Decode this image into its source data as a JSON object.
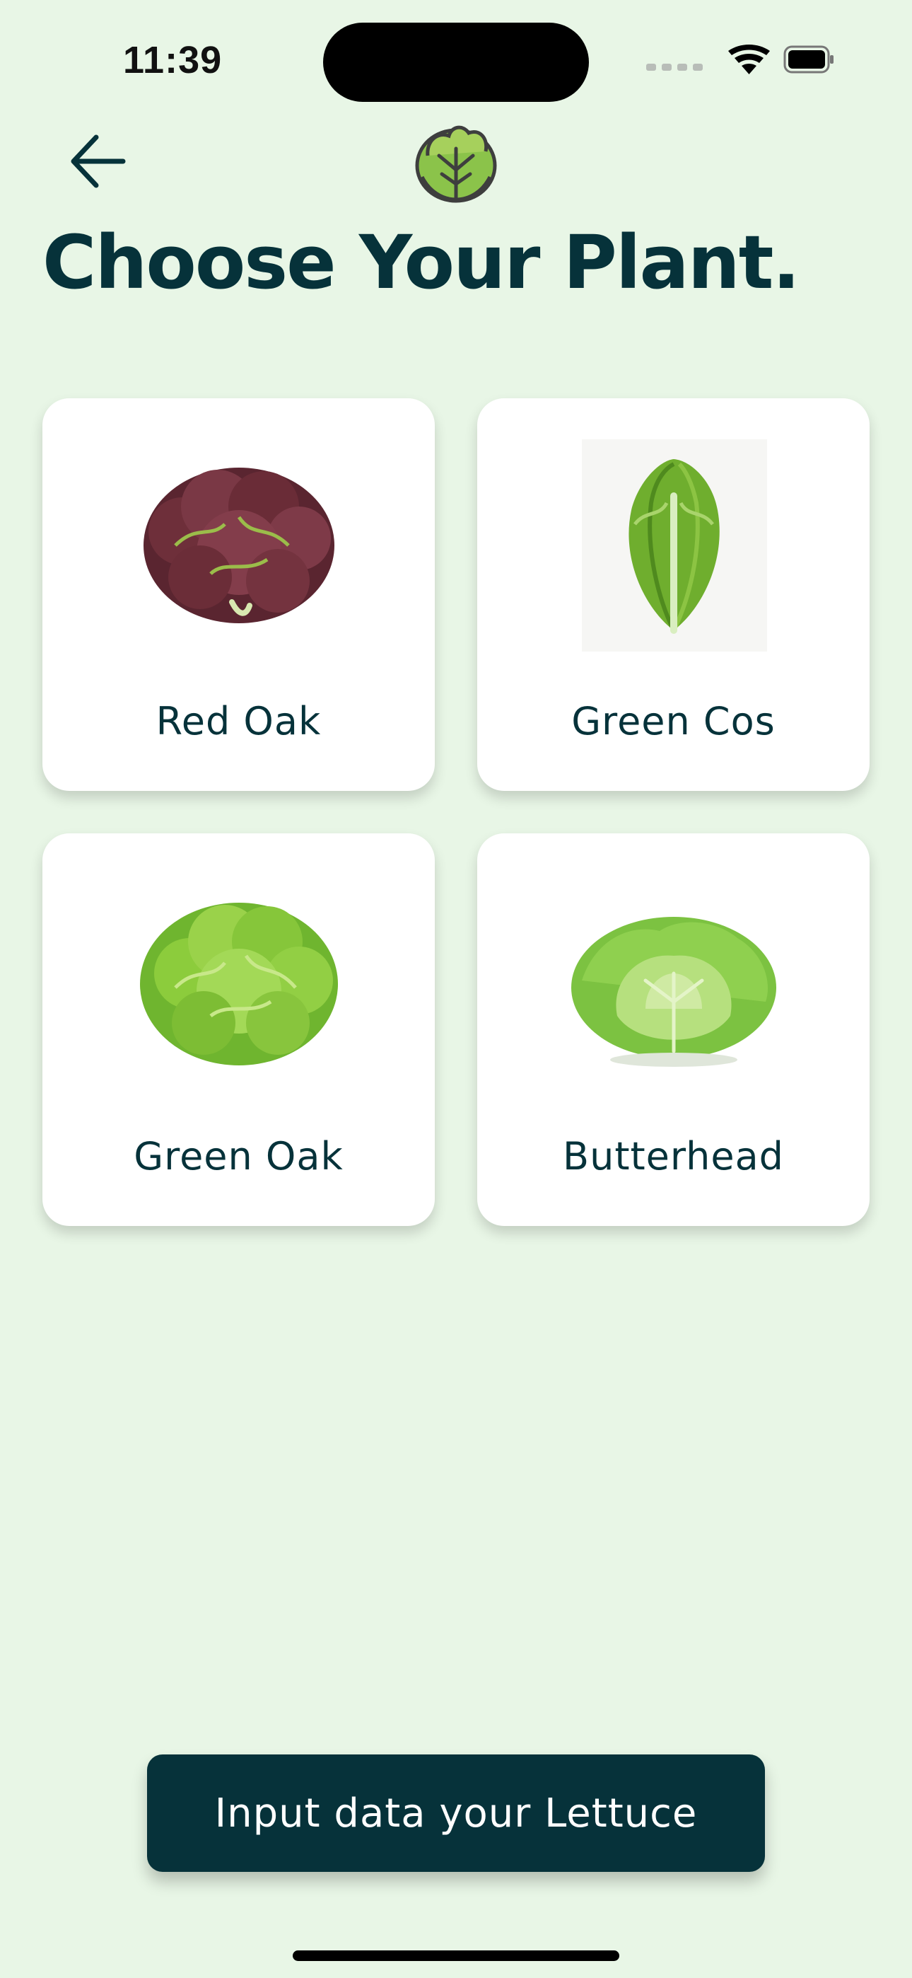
{
  "status_bar": {
    "time": "11:39",
    "icons": [
      "signal-icon",
      "wifi-icon",
      "battery-icon"
    ]
  },
  "header": {
    "back_icon": "arrow-left-icon",
    "logo_icon": "lettuce-logo-icon"
  },
  "title": "Choose Your Plant.",
  "plants": [
    {
      "label": "Red Oak",
      "icon": "red-oak-lettuce-image"
    },
    {
      "label": "Green Cos",
      "icon": "green-cos-lettuce-image"
    },
    {
      "label": "Green Oak",
      "icon": "green-oak-lettuce-image"
    },
    {
      "label": "Butterhead",
      "icon": "butterhead-lettuce-image"
    }
  ],
  "cta": {
    "label": "Input data your Lettuce"
  },
  "colors": {
    "background": "#e8f6e6",
    "primary": "#06323a",
    "card": "#ffffff"
  }
}
